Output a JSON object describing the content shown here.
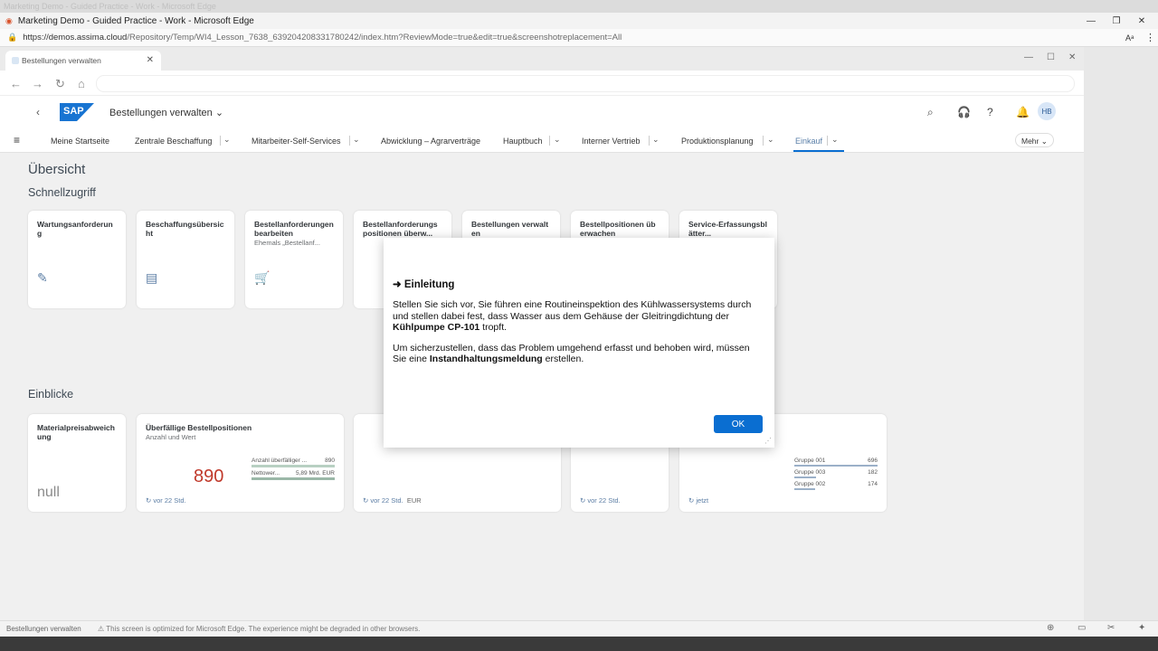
{
  "top_strip": "Marketing Demo - Guided Practice - Work - Microsoft Edge",
  "edge": {
    "window_title": "Marketing Demo - Guided Practice - Work - Microsoft Edge",
    "url_host": "https://demos.assima.cloud",
    "url_path": "/Repository/Temp/WI4_Lesson_7638_639204208331780242/index.htm?ReviewMode=true&edit=true&screenshotreplacement=All"
  },
  "inner_browser": {
    "tab_title": "Bestellungen verwalten"
  },
  "shell": {
    "app_title": "Bestellungen verwalten",
    "avatar": "HB"
  },
  "menu": {
    "items": [
      "Meine Startseite",
      "Zentrale Beschaffung",
      "Mitarbeiter-Self-Services",
      "Abwicklung – Agrarverträge",
      "Hauptbuch",
      "Interner Vertrieb",
      "Produktionsplanung",
      "Einkauf"
    ],
    "more": "Mehr"
  },
  "page": {
    "title": "Übersicht",
    "quick_access": "Schnellzugriff",
    "insights": "Einblicke"
  },
  "quick_tiles": [
    {
      "title": "Wartungsanforderung",
      "subtitle": ""
    },
    {
      "title": "Beschaffungsübersicht",
      "subtitle": ""
    },
    {
      "title": "Bestellanforderungen bearbeiten",
      "subtitle": "Ehemals „Bestellanf..."
    },
    {
      "title": "Bestellanforderungs positionen überw...",
      "subtitle": ""
    },
    {
      "title": "Bestellungen verwalten",
      "subtitle": ""
    },
    {
      "title": "Bestellpositionen überwachen",
      "subtitle": ""
    },
    {
      "title": "Service-Erfassungsblätter...",
      "subtitle": ""
    }
  ],
  "insight_tiles": {
    "t1": {
      "title": "Materialpreisabweichung",
      "value": "null"
    },
    "t2": {
      "title": "Überfällige Bestellpositionen",
      "subtitle": "Anzahl und Wert",
      "value": "890",
      "legend1": "Anzahl überfälliger ...",
      "legend1_val": "890",
      "legend2": "Nettower...",
      "legend2_val": "5,89 Mrd. EUR",
      "footer": "vor 22 Std."
    },
    "t3": {
      "footer": "vor 22 Std.",
      "unit": "EUR"
    },
    "t4": {
      "footer": "vor 22 Std."
    },
    "t5": {
      "footer": "jetzt",
      "g1": "Gruppe 001",
      "g1v": "696",
      "g2": "Gruppe 003",
      "g2v": "182",
      "g3": "Gruppe 002",
      "g3v": "174"
    }
  },
  "dialog": {
    "title": "➜ Einleitung",
    "p1_a": "Stellen Sie sich vor, Sie führen eine Routineinspektion des Kühlwassersystems durch und stellen dabei fest, dass Wasser aus dem Gehäuse der Gleitringdichtung der ",
    "p1_b": "Kühlpumpe CP-101",
    "p1_c": " tropft.",
    "p2_a": "Um sicherzustellen, dass das Problem umgehend erfasst und behoben wird, müssen Sie eine ",
    "p2_b": "Instandhaltungsmeldung",
    "p2_c": " erstellen.",
    "ok": "OK"
  },
  "status": {
    "left": "Bestellungen verwalten",
    "warning": "⚠ This screen is optimized for Microsoft Edge. The experience might be degraded in other browsers."
  }
}
